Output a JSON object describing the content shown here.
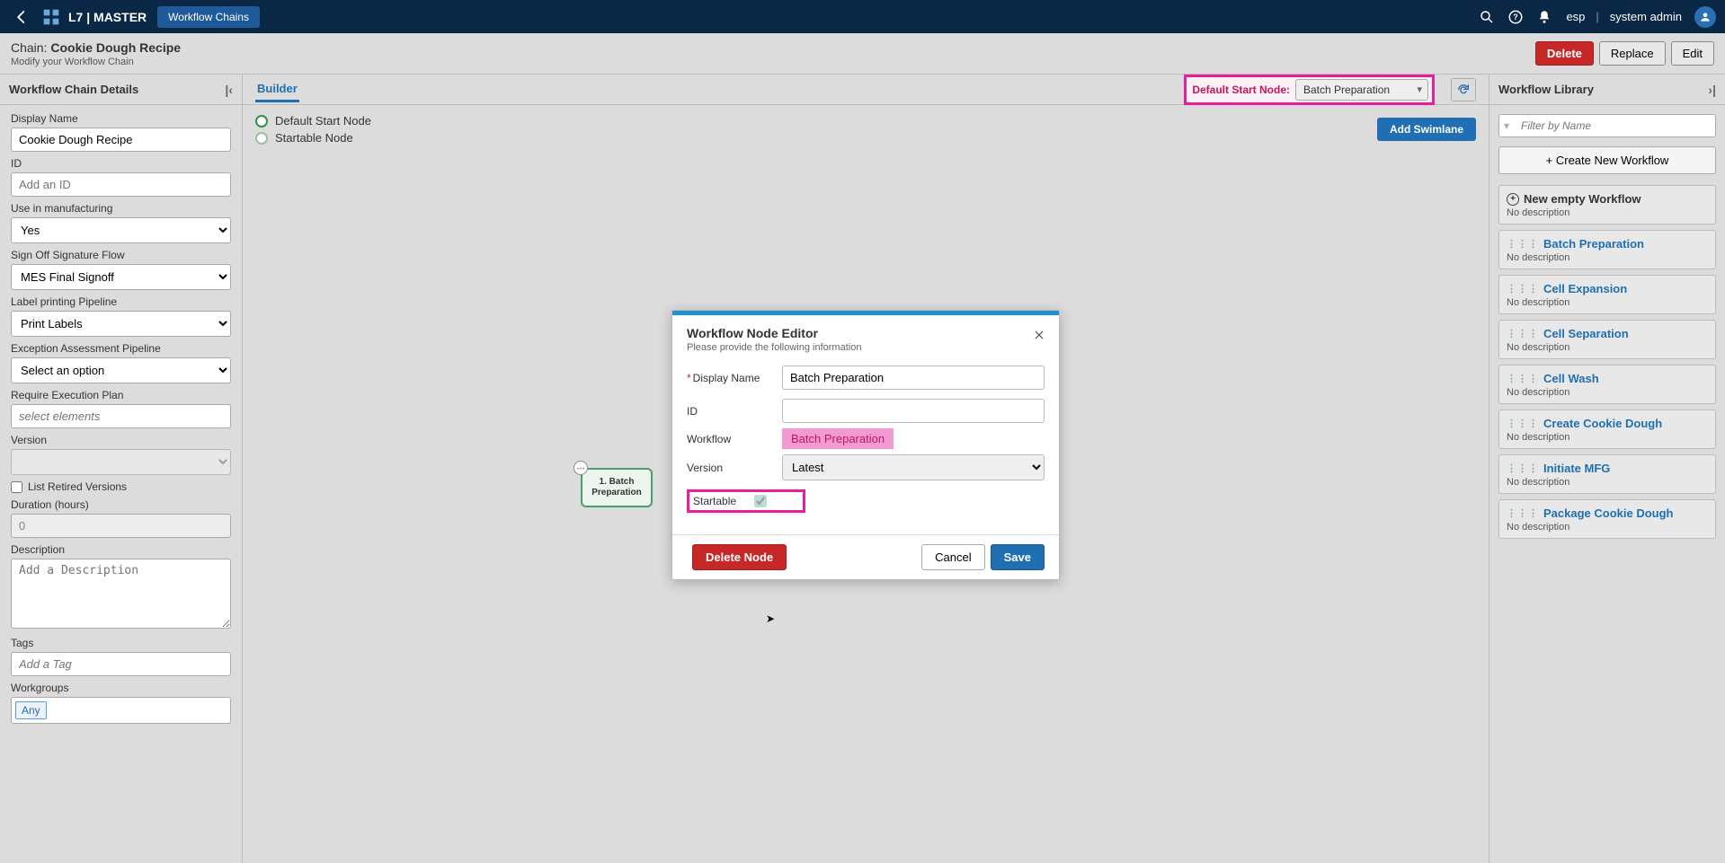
{
  "topnav": {
    "brand": "L7 | MASTER",
    "chip": "Workflow Chains",
    "lang": "esp",
    "user": "system admin"
  },
  "header": {
    "prefix": "Chain: ",
    "title": "Cookie Dough Recipe",
    "subtitle": "Modify your Workflow Chain",
    "delete": "Delete",
    "replace": "Replace",
    "edit": "Edit"
  },
  "leftPanel": {
    "title": "Workflow Chain Details",
    "displayName_label": "Display Name",
    "displayName_value": "Cookie Dough Recipe",
    "id_label": "ID",
    "id_placeholder": "Add an ID",
    "mfg_label": "Use in manufacturing",
    "mfg_value": "Yes",
    "signoff_label": "Sign Off Signature Flow",
    "signoff_value": "MES Final Signoff",
    "labelpipe_label": "Label printing Pipeline",
    "labelpipe_value": "Print Labels",
    "exception_label": "Exception Assessment Pipeline",
    "exception_value": "Select an option",
    "reqexec_label": "Require Execution Plan",
    "reqexec_placeholder": "select elements",
    "version_label": "Version",
    "retired_label": "List Retired Versions",
    "duration_label": "Duration (hours)",
    "duration_value": "0",
    "desc_label": "Description",
    "desc_placeholder": "Add a Description",
    "tags_label": "Tags",
    "tags_placeholder": "Add a Tag",
    "workgroups_label": "Workgroups",
    "workgroups_tag": "Any"
  },
  "center": {
    "tab": "Builder",
    "defaultStart_label": "Default Start Node:",
    "defaultStart_value": "Batch Preparation",
    "legend_default": "Default Start Node",
    "legend_startable": "Startable Node",
    "addSwimlane": "Add Swimlane",
    "node_label": "1. Batch Preparation"
  },
  "rightPanel": {
    "title": "Workflow Library",
    "filter_placeholder": "Filter by Name",
    "create_label": "+  Create New Workflow",
    "items": [
      {
        "title": "New empty Workflow",
        "desc": "No description",
        "first": true
      },
      {
        "title": "Batch Preparation",
        "desc": "No description"
      },
      {
        "title": "Cell Expansion",
        "desc": "No description"
      },
      {
        "title": "Cell Separation",
        "desc": "No description"
      },
      {
        "title": "Cell Wash",
        "desc": "No description"
      },
      {
        "title": "Create Cookie Dough",
        "desc": "No description"
      },
      {
        "title": "Initiate MFG",
        "desc": "No description"
      },
      {
        "title": "Package Cookie Dough",
        "desc": "No description"
      }
    ]
  },
  "modal": {
    "title": "Workflow Node Editor",
    "subtitle": "Please provide the following information",
    "dn_label": "Display Name",
    "dn_value": "Batch Preparation",
    "id_label": "ID",
    "wf_label": "Workflow",
    "wf_value": "Batch Preparation",
    "ver_label": "Version",
    "ver_value": "Latest",
    "startable_label": "Startable",
    "deleteNode": "Delete Node",
    "cancel": "Cancel",
    "save": "Save"
  }
}
